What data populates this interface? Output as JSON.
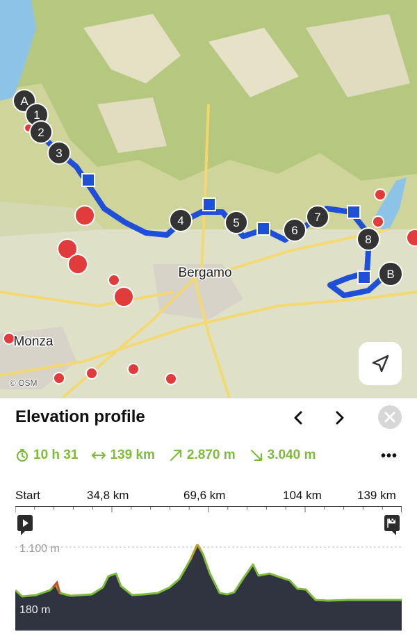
{
  "map": {
    "attribution": "© OSM",
    "cities": {
      "bergamo": "Bergamo",
      "monza": "Monza"
    },
    "route_start": "A",
    "route_end": "B",
    "waypoints": [
      "1",
      "2",
      "3",
      "4",
      "5",
      "6",
      "7",
      "8"
    ],
    "colors": {
      "route": "#1f4fd6",
      "poi": "#e23b3b",
      "marker": "#333333"
    }
  },
  "panel": {
    "title": "Elevation profile",
    "prev_icon": "chevron-left-icon",
    "next_icon": "chevron-right-icon",
    "close_icon": "close-icon",
    "more_label": "•••",
    "stats": {
      "duration": "10 h 31",
      "distance": "139 km",
      "ascent": "2.870 m",
      "descent": "3.040 m"
    },
    "axis": {
      "ticks": [
        "Start",
        "34,8 km",
        "69,6 km",
        "104 km",
        "139 km"
      ]
    },
    "elevation": {
      "max_label": "1.100 m",
      "min_label": "180 m",
      "profile_color": "#7dbb3a",
      "fill_color": "#2f3440"
    }
  }
}
